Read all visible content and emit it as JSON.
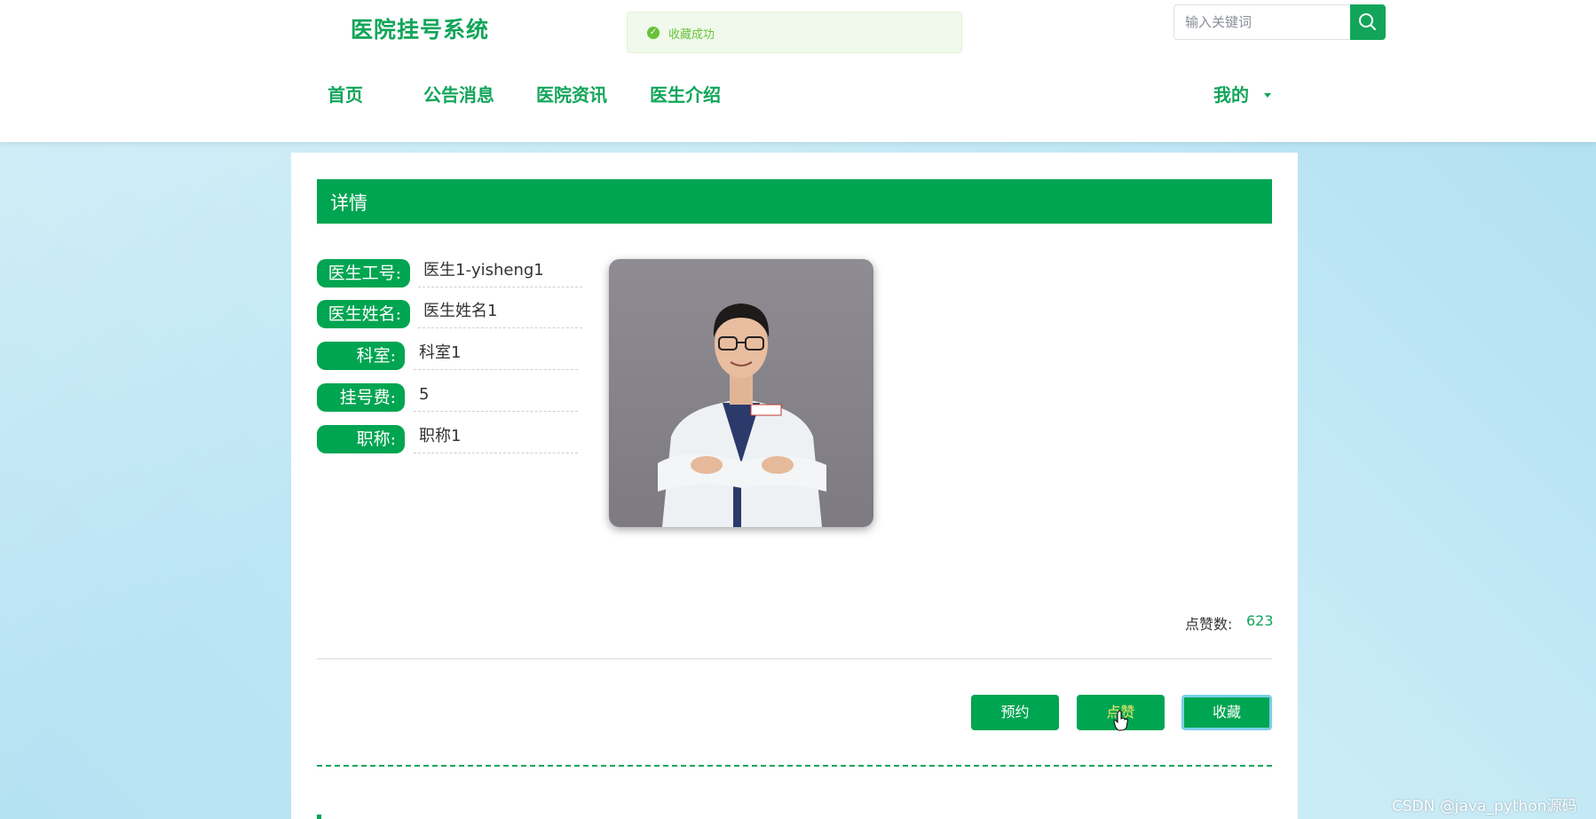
{
  "header": {
    "logo": "医院挂号系统",
    "toast": "收藏成功",
    "search_placeholder": "输入关键词",
    "nav": [
      "首页",
      "公告消息",
      "医院资讯",
      "医生介绍"
    ],
    "user_menu": "我的"
  },
  "detail": {
    "title": "详情",
    "fields": [
      {
        "label": "医生工号:",
        "value": "医生1-yisheng1"
      },
      {
        "label": "医生姓名:",
        "value": "医生姓名1"
      },
      {
        "label": "科室:",
        "value": "科室1"
      },
      {
        "label": "挂号费:",
        "value": "5"
      },
      {
        "label": "职称:",
        "value": "职称1"
      }
    ],
    "likes_label": "点赞数:",
    "likes_count": "623",
    "buttons": {
      "book": "预约",
      "like": "点赞",
      "favorite": "收藏"
    }
  },
  "watermark": "CSDN @java_python源码",
  "colors": {
    "brand": "#00a551",
    "toast_text": "#67c23a"
  }
}
